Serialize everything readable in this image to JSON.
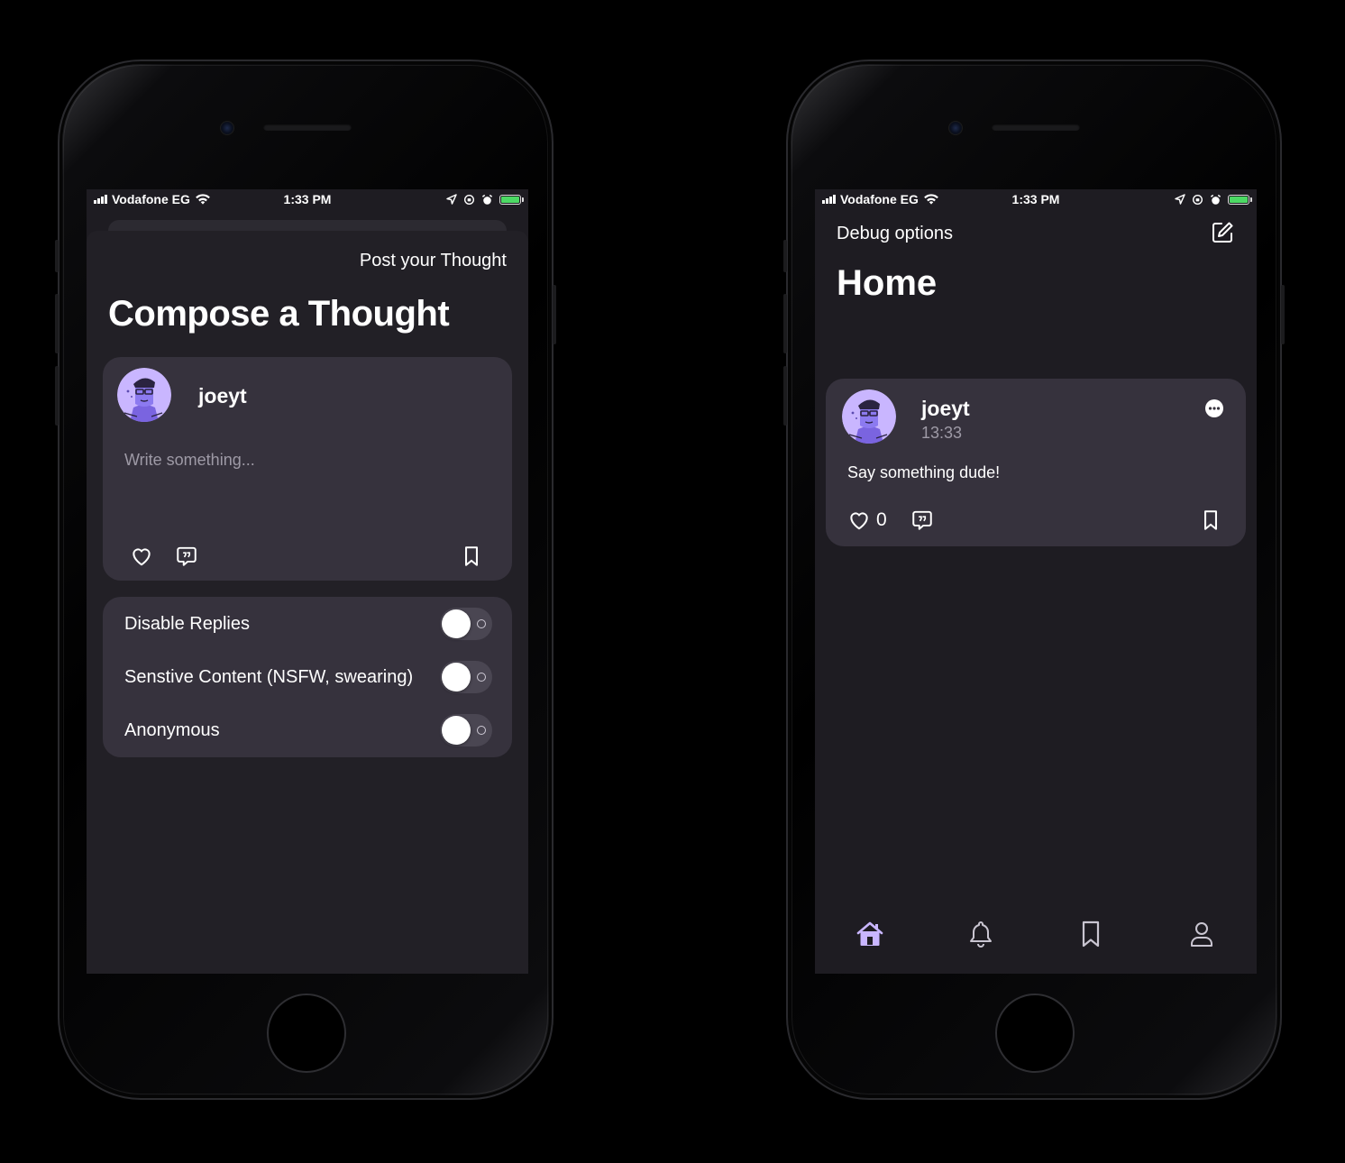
{
  "status_bar": {
    "carrier": "Vodafone EG",
    "time": "1:33 PM"
  },
  "compose": {
    "post_action": "Post your Thought",
    "title": "Compose a Thought",
    "username": "joeyt",
    "placeholder": "Write something...",
    "options": [
      {
        "label": "Disable Replies"
      },
      {
        "label": "Senstive Content (NSFW, swearing)"
      },
      {
        "label": "Anonymous"
      }
    ]
  },
  "home": {
    "debug_link": "Debug options",
    "title": "Home",
    "post": {
      "username": "joeyt",
      "timestamp": "13:33",
      "body": "Say something dude!",
      "like_count": "0"
    }
  },
  "colors": {
    "background": "#1e1c22",
    "card": "#36323d",
    "accent": "#b9a2ff",
    "muted_text": "#9e9aa6",
    "battery": "#4cd964"
  },
  "icons": [
    "heart-icon",
    "quote-bubble-icon",
    "bookmark-icon",
    "compose-icon",
    "more-icon",
    "home-icon",
    "bell-icon",
    "bookmark-tab-icon",
    "profile-icon"
  ]
}
